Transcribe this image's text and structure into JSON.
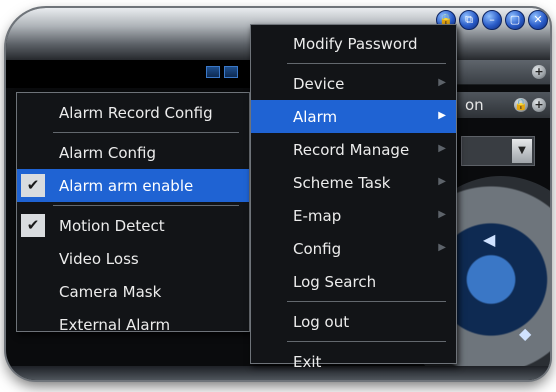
{
  "window_controls": [
    {
      "name": "lock-icon",
      "glyph": "🔒"
    },
    {
      "name": "restore-icon",
      "glyph": "⧉"
    },
    {
      "name": "minimize-icon",
      "glyph": "–"
    },
    {
      "name": "maximize-icon",
      "glyph": "▢"
    },
    {
      "name": "close-icon",
      "glyph": "✕"
    }
  ],
  "main_menu": {
    "items": [
      {
        "label": "Modify Password",
        "has_submenu": false
      },
      {
        "label": "Device",
        "has_submenu": true
      },
      {
        "label": "Alarm",
        "has_submenu": true,
        "highlighted": true
      },
      {
        "label": "Record Manage",
        "has_submenu": true
      },
      {
        "label": "Scheme Task",
        "has_submenu": true
      },
      {
        "label": "E-map",
        "has_submenu": true
      },
      {
        "label": "Config",
        "has_submenu": true
      },
      {
        "label": "Log Search",
        "has_submenu": false
      },
      {
        "label": "Log out",
        "has_submenu": false
      },
      {
        "label": "Exit",
        "has_submenu": false
      }
    ]
  },
  "alarm_submenu": {
    "items": [
      {
        "label": "Alarm Record Config",
        "checked": false
      },
      {
        "label": "Alarm Config",
        "checked": false
      },
      {
        "label": "Alarm arm enable",
        "checked": true,
        "highlighted": true
      },
      {
        "label": "Motion Detect",
        "checked": true
      },
      {
        "label": "Video Loss",
        "checked": false
      },
      {
        "label": "Camera Mask",
        "checked": false
      },
      {
        "label": "External Alarm",
        "checked": false
      }
    ]
  },
  "background_panel": {
    "partial_text": "on",
    "expand_glyph": "+",
    "lock_glyph": "🔒",
    "dropdown_glyph": "▼"
  },
  "colors": {
    "highlight": "#1f63d3",
    "menu_bg": "#121417",
    "check_bg": "#d9dcdf"
  }
}
